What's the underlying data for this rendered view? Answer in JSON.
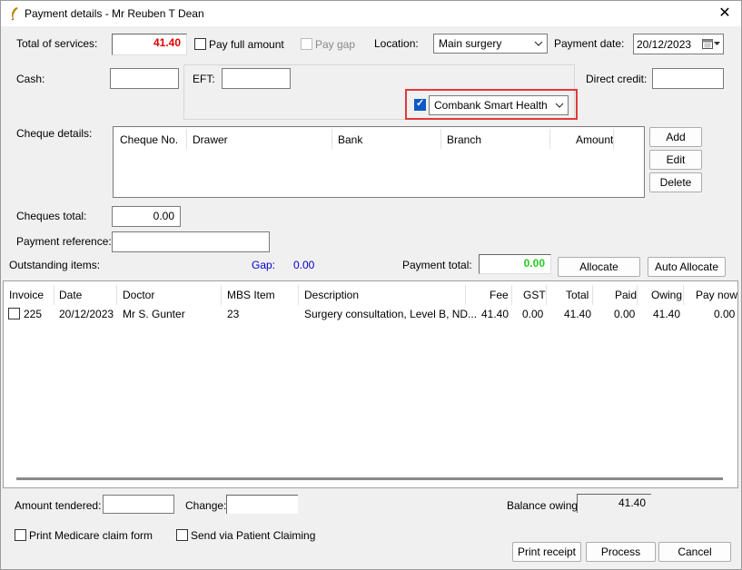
{
  "window": {
    "title": "Payment details - Mr Reuben T Dean",
    "close": "✕"
  },
  "form": {
    "total_services_label": "Total of services:",
    "total_services_value": "41.40",
    "pay_full_amount": "Pay full amount",
    "pay_gap": "Pay gap",
    "location_label": "Location:",
    "location_value": "Main surgery",
    "payment_date_label": "Payment date:",
    "payment_date_value": "20/12/2023",
    "cash_label": "Cash:",
    "eft_label": "EFT:",
    "direct_credit_label": "Direct credit:",
    "eft_provider_value": "Combank Smart Health",
    "cheque_details_label": "Cheque details:",
    "cheques_total_label": "Cheques total:",
    "cheques_total_value": "0.00",
    "payment_reference_label": "Payment reference:",
    "outstanding_label": "Outstanding items:",
    "gap_label": "Gap:",
    "gap_value": "0.00",
    "payment_total_label": "Payment total:",
    "payment_total_value": "0.00"
  },
  "cheque_table": {
    "columns": [
      "Cheque No.",
      "Drawer",
      "Bank",
      "Branch",
      "Amount"
    ]
  },
  "cheque_buttons": {
    "add": "Add",
    "edit": "Edit",
    "delete": "Delete"
  },
  "allocate_buttons": {
    "allocate": "Allocate",
    "auto_allocate": "Auto Allocate"
  },
  "items_table": {
    "columns": [
      "Invoice",
      "Date",
      "Doctor",
      "MBS Item",
      "Description",
      "Fee",
      "GST",
      "Total",
      "Paid",
      "Owing",
      "Pay now"
    ],
    "rows": [
      {
        "invoice": "225",
        "date": "20/12/2023",
        "doctor": "Mr S. Gunter",
        "mbs_item": "23",
        "description": "Surgery consultation, Level B, ND...",
        "fee": "41.40",
        "gst": "0.00",
        "total": "41.40",
        "paid": "0.00",
        "owing": "41.40",
        "pay_now": "0.00"
      }
    ]
  },
  "footer": {
    "amount_tendered_label": "Amount tendered:",
    "change_label": "Change:",
    "balance_owing_label": "Balance owing:",
    "balance_owing_value": "41.40",
    "print_medicare": "Print Medicare claim form",
    "send_patient_claiming": "Send via Patient Claiming",
    "print_receipt": "Print receipt",
    "process": "Process",
    "cancel": "Cancel"
  },
  "colors": {
    "total_red": "#e00000",
    "payment_total_green": "#22cc22",
    "gap_blue": "#0000cc",
    "highlight_red": "#e3393a"
  }
}
